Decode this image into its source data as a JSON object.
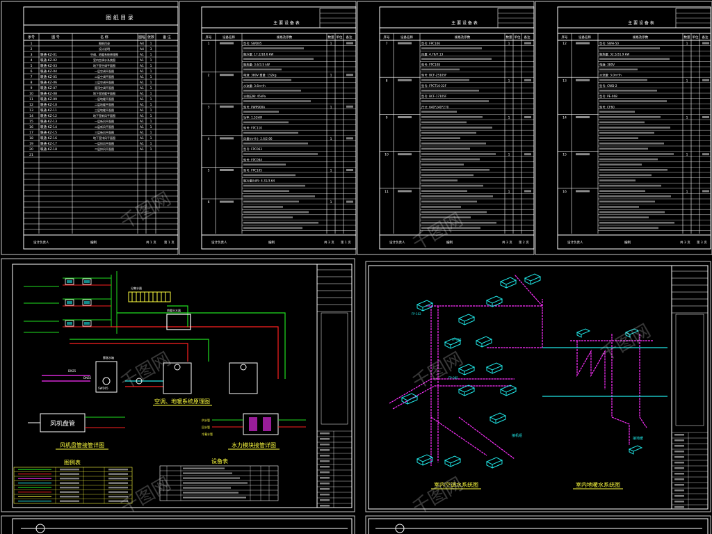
{
  "sheets": [
    {
      "id": "sheet-1",
      "title": "图 纸 目 录",
      "columns": [
        "序号",
        "图 号",
        "名 称",
        "图幅",
        "张数",
        "备 注"
      ],
      "footer": [
        "设计负责人",
        "编制",
        "共 1 页",
        "第 1 页"
      ]
    },
    {
      "id": "sheet-2",
      "title": "主 要 设 备 表",
      "columns": [
        "序号",
        "设备名称",
        "规格及参数",
        "数量",
        "单位",
        "备注"
      ],
      "groups": [
        "1",
        "2",
        "3",
        "4",
        "5",
        "6"
      ],
      "rows": [
        "型号: SWD05",
        "制冷量: 17.2/18.6 kW",
        "制热量: 3.6/3.5 kW",
        "电源: 380V  重量: 152kg",
        "水流量: 3.6m³/h",
        "水侧压降: 45kPa",
        "型号: PWP900A",
        "功率: 1.53kW",
        "型号: FPC110",
        "风量(m³/h): 2.6/2.66",
        "型号: FPC063",
        "型号: FPC094",
        "型号: FPC105",
        "制冷量(kW): 4.31/3.64"
      ],
      "footer": [
        "设计负责人",
        "编制",
        "共 3 页",
        "第 1 页"
      ]
    },
    {
      "id": "sheet-3",
      "title": "主 要 设 备 表",
      "columns": [
        "序号",
        "设备名称",
        "规格及参数",
        "数量",
        "单位",
        "备注"
      ],
      "groups": [
        "7",
        "8",
        "9",
        "10",
        "11"
      ],
      "rows": [
        "型号: FPC106",
        "风量: 4.76/7.13",
        "型号: FPC108",
        "型号: BCF-25105F",
        "型号: FPCT10-22F",
        "型号: BCF-17105F",
        "尺寸: 640*240*270"
      ],
      "footer": [
        "设计负责人",
        "编制",
        "共 3 页",
        "第 2 页"
      ]
    },
    {
      "id": "sheet-4",
      "title": "主 要 设 备 表",
      "columns": [
        "序号",
        "设备名称",
        "规格及参数",
        "数量",
        "单位",
        "备注"
      ],
      "groups": [
        "12",
        "13",
        "14",
        "15",
        "16"
      ],
      "rows": [
        "型号: SWH-50",
        "制热量: 32.5/31.9 kW",
        "电源: 380V",
        "水流量: 3.0m³/h",
        "型号: CWD-2",
        "型号: PE-068",
        "型号: CF60"
      ],
      "footer": [
        "设计负责人",
        "编制",
        "共 3 页",
        "第 3 页"
      ]
    }
  ],
  "index_rows": [
    {
      "no": "1",
      "code": "",
      "name": "图纸目录",
      "size": "A4",
      "count": "1"
    },
    {
      "no": "2",
      "code": "",
      "name": "设计说明",
      "size": "A4",
      "count": "3"
    },
    {
      "no": "3",
      "code": "暖通-KZ-01",
      "name": "空调、地暖系统原理图",
      "size": "A1",
      "count": "1"
    },
    {
      "no": "4",
      "code": "暖通-KZ-02",
      "name": "室内空调水系统图",
      "size": "A1",
      "count": "1"
    },
    {
      "no": "5",
      "code": "暖通-KZ-03",
      "name": "地下室空调平面图",
      "size": "A1",
      "count": "1"
    },
    {
      "no": "6",
      "code": "暖通-KZ-04",
      "name": "一层空调平面图",
      "size": "A1",
      "count": "1"
    },
    {
      "no": "7",
      "code": "暖通-KZ-05",
      "name": "二层空调平面图",
      "size": "A1",
      "count": "1"
    },
    {
      "no": "8",
      "code": "暖通-KZ-06",
      "name": "三层空调平面图",
      "size": "A1",
      "count": "1"
    },
    {
      "no": "9",
      "code": "暖通-KZ-07",
      "name": "屋顶空调平面图",
      "size": "A1",
      "count": "1"
    },
    {
      "no": "10",
      "code": "暖通-KZ-08",
      "name": "地下室地暖平面图",
      "size": "A1",
      "count": "1"
    },
    {
      "no": "11",
      "code": "暖通-KZ-09",
      "name": "一层地暖平面图",
      "size": "A1",
      "count": "1"
    },
    {
      "no": "12",
      "code": "暖通-KZ-10",
      "name": "二层地暖平面图",
      "size": "A1",
      "count": "1"
    },
    {
      "no": "13",
      "code": "暖通-KZ-11",
      "name": "三层地暖平面图",
      "size": "A1",
      "count": "1"
    },
    {
      "no": "14",
      "code": "暖通-KZ-12",
      "name": "地下室新风平面图",
      "size": "A1",
      "count": "1"
    },
    {
      "no": "15",
      "code": "暖通-KZ-13",
      "name": "一层新风平面图",
      "size": "A1",
      "count": "1"
    },
    {
      "no": "16",
      "code": "暖通-KZ-14",
      "name": "二层新风平面图",
      "size": "A1",
      "count": "1"
    },
    {
      "no": "17",
      "code": "暖通-KZ-15",
      "name": "三层新风平面图",
      "size": "A1",
      "count": "1"
    },
    {
      "no": "18",
      "code": "暖通-KZ-16",
      "name": "地下室排风平面图",
      "size": "A1",
      "count": "1"
    },
    {
      "no": "19",
      "code": "暖通-KZ-17",
      "name": "一层排风平面图",
      "size": "A1",
      "count": "1"
    },
    {
      "no": "20",
      "code": "暖通-KZ-18",
      "name": "二层排风平面图",
      "size": "A1",
      "count": "1"
    },
    {
      "no": "21",
      "code": "",
      "name": "",
      "size": "",
      "count": ""
    }
  ],
  "schematic": {
    "main_caption": "空调、地暖系统原理图",
    "fcu_label": "风机盘管",
    "fcu_caption": "风机盘管接管详图",
    "module_caption": "水力模块接管详图",
    "legend_title": "图例表",
    "equipment_title": "设备表",
    "labels": [
      "膨胀水箱",
      "SWD05",
      "地暖分水器",
      "分集水器",
      "DN32",
      "DN25",
      "供水管",
      "回水管",
      "冷凝水管"
    ]
  },
  "isometric": {
    "left_caption": "室内空调水系统图",
    "right_caption": "室内地暖水系统图",
    "labels": [
      "FP-102",
      "FP-094",
      "FP-085",
      "接机组",
      "接地暖"
    ]
  },
  "watermark": "千图网",
  "colors": {
    "background": "#000000",
    "frame": "#ffffff",
    "pipe_red": "#ff2020",
    "pipe_green": "#20e020",
    "pipe_magenta": "#ff30ff",
    "pipe_cyan": "#20e8e8",
    "text_yellow": "#ffff40"
  }
}
